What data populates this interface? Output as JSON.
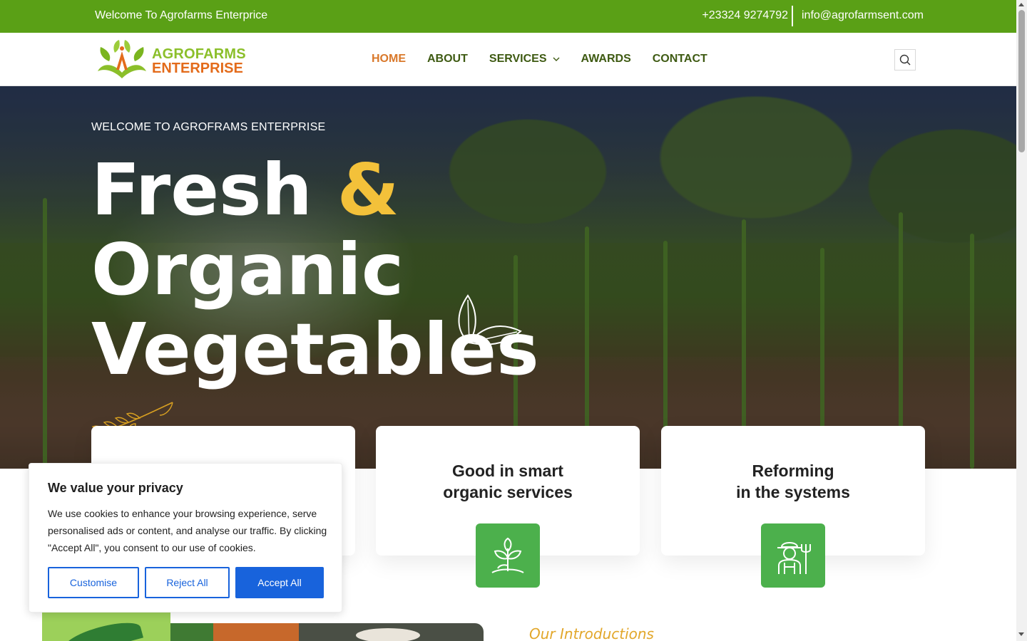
{
  "topbar": {
    "welcome": "Welcome To Agrofarms Enterprice",
    "phone": "+23324 9274792",
    "email": "info@agrofarmsent.com"
  },
  "logo": {
    "line1": "AGROFARMS",
    "line2": "ENTERPRISE"
  },
  "nav": [
    {
      "label": "HOME",
      "active": true
    },
    {
      "label": "ABOUT",
      "active": false
    },
    {
      "label": "SERVICES",
      "active": false,
      "dropdown": true
    },
    {
      "label": "AWARDS",
      "active": false
    },
    {
      "label": "CONTACT",
      "active": false
    }
  ],
  "hero": {
    "subtitle": "WELCOME TO AGROFRAMS ENTERPRISE",
    "title_word1": "Fresh",
    "title_amp": "&",
    "title_word2": "Organic",
    "title_word3": "Vegetables"
  },
  "cards": [
    {
      "line1": "Good in smart",
      "line2": "organic services",
      "icon": "plant-sprout-icon"
    },
    {
      "line1": "Reforming",
      "line2": "in the systems",
      "icon": "farmer-icon"
    }
  ],
  "intro_label": "Our Introductions",
  "cookie": {
    "title": "We value your privacy",
    "text": "We use cookies to enhance your browsing experience, serve personalised ads or content, and analyse our traffic. By clicking \"Accept All\", you consent to our use of cookies.",
    "customise": "Customise",
    "reject": "Reject All",
    "accept": "Accept All"
  },
  "colors": {
    "topbar_green": "#5aa016",
    "nav_active": "#d9782a",
    "nav_text": "#3e5a12",
    "card_icon_bg": "#4cb04c",
    "accent_yellow": "#f3c13a",
    "cookie_blue": "#1863dc"
  }
}
